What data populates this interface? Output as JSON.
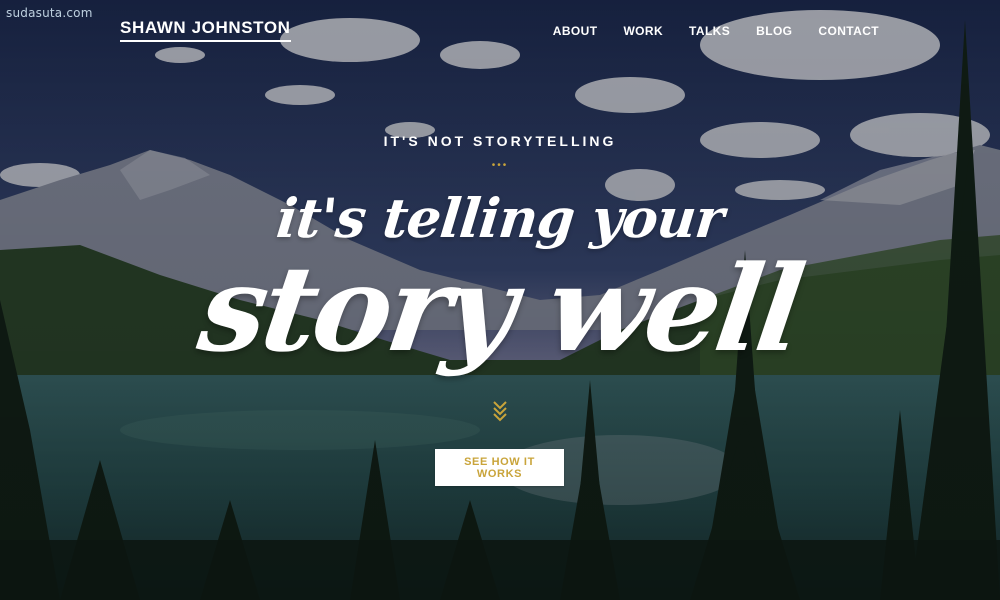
{
  "watermark": "sudasuta.com",
  "brand": {
    "name": "SHAWN JOHNSTON"
  },
  "nav": {
    "items": [
      {
        "label": "ABOUT"
      },
      {
        "label": "WORK"
      },
      {
        "label": "TALKS"
      },
      {
        "label": "BLOG"
      },
      {
        "label": "CONTACT"
      }
    ]
  },
  "hero": {
    "eyebrow": "IT'S NOT STORYTELLING",
    "divider": "•••",
    "headline_line1": "it's telling your",
    "headline_line2": "story well",
    "scroll_icon": "chevron-down-double-icon",
    "cta_label": "SEE HOW IT WORKS"
  },
  "colors": {
    "accent": "#c9a43a",
    "text": "#ffffff",
    "sky": "#2d3f66",
    "lake": "#2c5a5e"
  }
}
